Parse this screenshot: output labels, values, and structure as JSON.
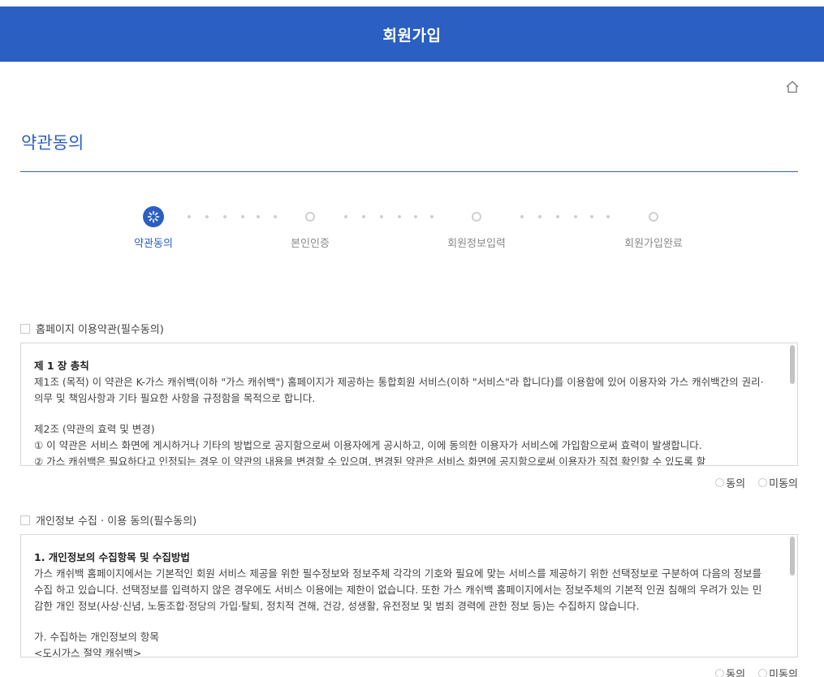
{
  "header": {
    "title": "회원가입"
  },
  "page": {
    "title": "약관동의"
  },
  "icons": {
    "home": "home-icon",
    "spinner": "loading-spinner-icon"
  },
  "colors": {
    "brand": "#2b5fc1",
    "inactive": "#cfcfcf"
  },
  "steps": [
    {
      "label": "약관동의",
      "state": "current"
    },
    {
      "label": "본인인증",
      "state": "pending"
    },
    {
      "label": "회원정보입력",
      "state": "pending"
    },
    {
      "label": "회원가입완료",
      "state": "pending"
    }
  ],
  "terms": {
    "checkbox_label": "홈페이지 이용약관(필수동의)",
    "heading": "제 1 장 총칙",
    "p1": "제1조 (목적) 이 약관은 K-가스 캐쉬백(이하 \"가스 캐쉬백\") 홈페이지가 제공하는 통합회원 서비스(이하 \"서비스\"라 합니다)를 이용함에 있어 이용자와 가스 캐쉬백간의 권리·의무 및 책임사항과 기타 필요한 사항을 규정함을 목적으로 합니다.",
    "p2": "제2조 (약관의 효력 및 변경)",
    "p3": "① 이 약관은 서비스 화면에 게시하거나 기타의 방법으로 공지함으로써 이용자에게 공시하고, 이에 동의한 이용자가 서비스에 가입함으로써 효력이 발생합니다.",
    "p4": "② 가스 캐쉬백은 필요하다고 인정되는 경우 이 약관의 내용을 변경할 수 있으며, 변경된 약관은 서비스 화면에 공지함으로써 이용자가 직접 확인할 수 있도록 할",
    "agree": "동의",
    "disagree": "미동의"
  },
  "privacy": {
    "checkbox_label": "개인정보 수집 · 이용 동의(필수동의)",
    "heading": "1. 개인정보의 수집항목 및 수집방법",
    "p1": "가스 캐쉬백 홈페이지에서는 기본적인 회원 서비스 제공을 위한 필수정보와 정보주체 각각의 기호와 필요에 맞는 서비스를 제공하기 위한 선택정보로 구분하여 다음의 정보를 수집 하고 있습니다. 선택정보를 입력하지 않은 경우에도 서비스 이용에는 제한이 없습니다. 또한 가스 캐쉬백 홈페이지에서는 정보주체의 기본적 인권 침해의 우려가 있는 민감한 개인 정보(사상·신념, 노동조합·정당의 가입·탈퇴, 정치적 견해, 건강, 성생활, 유전정보 및 범죄 경력에 관한 정보 등)는 수집하지 않습니다.",
    "p2": "가. 수집하는 개인정보의 항목",
    "p3": "<도시가스 절약 캐쉬백>",
    "agree": "동의",
    "disagree": "미동의"
  }
}
